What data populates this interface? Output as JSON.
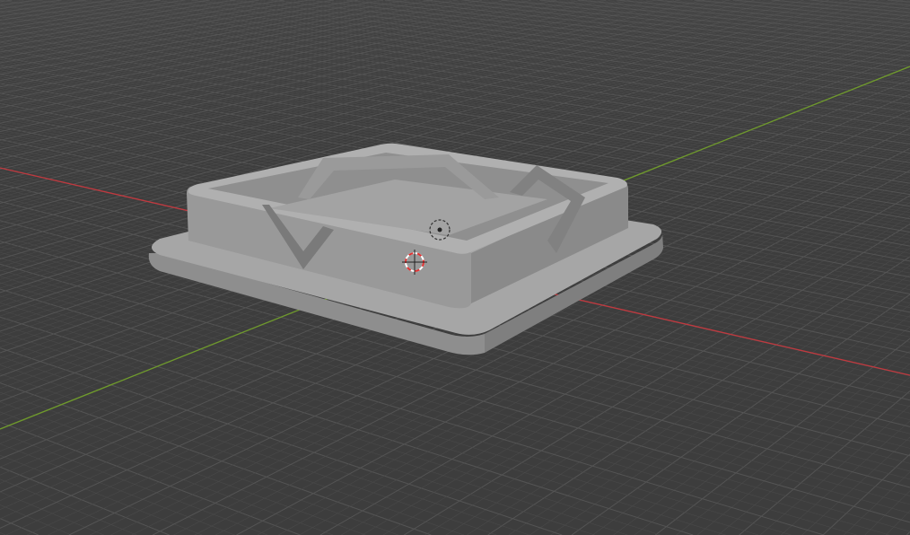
{
  "viewport": {
    "background_color": "#3d3d3d",
    "grid_color": "#4a4a4a",
    "grid_major_color": "#545454",
    "x_axis_color": "#c0393f",
    "y_axis_color": "#6f9a2c"
  },
  "object": {
    "type": "ashtray-mesh",
    "top_color": "#a4a4a4",
    "side_color": "#8c8c8c",
    "dark_color": "#7a7a7a"
  },
  "cursor": {
    "icon": "3d-cursor-icon"
  },
  "origin": {
    "icon": "object-origin-icon"
  }
}
